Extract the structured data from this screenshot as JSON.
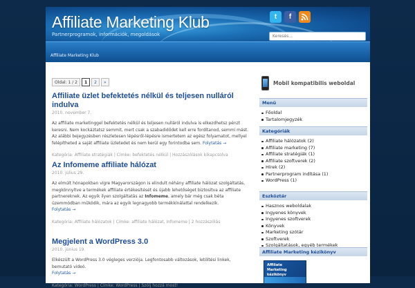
{
  "header": {
    "title": "Affiliate Marketing Klub",
    "tagline": "Partnerprogramok, információk, megoldások",
    "search_placeholder": "Keresés...",
    "social": [
      "t",
      "f",
      "rss"
    ]
  },
  "nav": {
    "item": "Affiliate Marketing Klub"
  },
  "pagination": {
    "label": "Oldal: 1 / 2",
    "current": "1",
    "next_page": "2",
    "next": "»"
  },
  "posts": [
    {
      "title": "Affiliate üzlet befektetés nélkül és teljesen nulláról indulva",
      "date": "2010. november 7.",
      "excerpt": "Az affiliate marketinggel befektetés nélkül és teljesen nulláról indulva is elkezdhetsz pénzt keresni. Nem kockáztatsz semmit, mert csak a szabadidődet kell erre fordítanod, semmi mást. Az alábbi bejegyzésben részletesen lépésről-lépésre ismertetem az egész folyamatot, mellyel felépítheted a saját affiliate üzletedet és nem kerül egy forintodba sem.",
      "more": "Folytatás →",
      "meta_category": "Kategória: Affiliate stratégiák",
      "meta_tags": "Címke: befektetés nélkül",
      "meta_comments": "Hozzászólások kikapcsolva"
    },
    {
      "title": "Az Infomeme affiliate hálózat",
      "date": "2010. július 29.",
      "excerpt_before": "Az elmúlt hónapokban vígre Magyarországon is elindult néhány affiliate hálózat szolgáltatás, megkönnyítve a termékek affiliate értékesítését és újabb lehetőséget biztosítva az affiliate partnereknek. Az egyik ilyen szolgáltatás az ",
      "excerpt_bold": "Infomeme",
      "excerpt_after": ", amely bár még csak béta üzemmódban működik, mára az egyik legnagyobb termékkínálattal rendelkezik.",
      "more": "Folytatás →",
      "meta_category": "Kategória: Affiliate hálózatok",
      "meta_tags": "Címke: affiliate hálózat, Infomeme",
      "meta_comments": "2 hozzászólás"
    },
    {
      "title": "Megjelent a WordPress 3.0",
      "date": "2010. június 19.",
      "excerpt": "Elkészült a WordPress 3.0 végleges verziója. Legfontosabb változások, letöltési linkek, bemutató videó.",
      "more": "Folytatás →",
      "meta_category": "Kategória: WordPress",
      "meta_tags": "Címke: WordPress",
      "meta_comments": "Szólj hozzá most!"
    }
  ],
  "sidebar": {
    "mobile_label": "Mobil kompatibilis weboldal",
    "menu": {
      "title": "Menü",
      "items": [
        "Főoldal",
        "Tartalomjegyzék"
      ]
    },
    "categories": {
      "title": "Kategóriák",
      "items": [
        "Affiliate hálózatok (2)",
        "Affiliate marketing (7)",
        "Affiliate stratégiák (1)",
        "Affiliate szoftverek (2)",
        "Hírek (2)",
        "Partnerprogram indítása (1)",
        "WordPress (1)"
      ]
    },
    "tools": {
      "title": "Eszköztár",
      "items": [
        "Hasznos weboldalak",
        "Ingyenes könyvek",
        "Ingyenes szoftverek",
        "Könyvek",
        "Marketing szótár",
        "Szoftverek",
        "Szolgáltatások, egyéb termékek"
      ]
    },
    "ebook": {
      "title": "Affiliate Marketing kézikönyv",
      "cover_text": "Affiliate Marketing kézikönyv"
    }
  }
}
